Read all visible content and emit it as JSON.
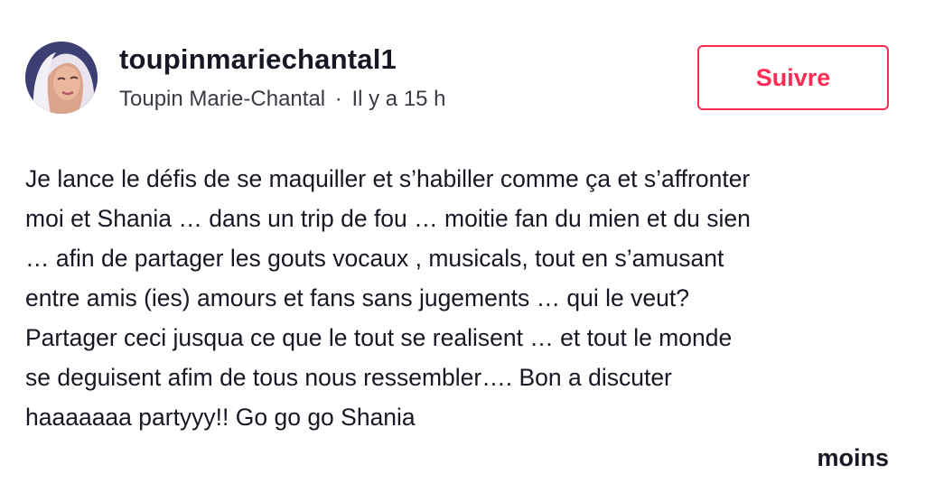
{
  "author": {
    "username": "toupinmariechantal1",
    "display_name": "Toupin Marie-Chantal",
    "separator": "·",
    "posted_time": "Il y a 15 h",
    "avatar_icon": "profile-photo"
  },
  "actions": {
    "follow_label": "Suivre"
  },
  "caption": {
    "lines": [
      "Je lance le défis de se maquiller et s’habiller comme ça et s’affronter",
      "moi et Shania … dans un trip de fou … moitie fan du mien et du sien",
      "… afin de partager les gouts vocaux , musicals, tout en s’amusant",
      "entre amis (ies) amours et fans sans jugements … qui le veut?",
      "Partager ceci jusqua ce que le tout se realisent … et tout le monde",
      "se deguisent afim de tous nous ressembler…. Bon a discuter",
      "haaaaaaa partyyy!! Go go go Shania"
    ],
    "collapse_label": "moins"
  },
  "colors": {
    "accent": "#fe2c55",
    "text_primary": "#161823",
    "text_secondary": "#3a3a44"
  }
}
